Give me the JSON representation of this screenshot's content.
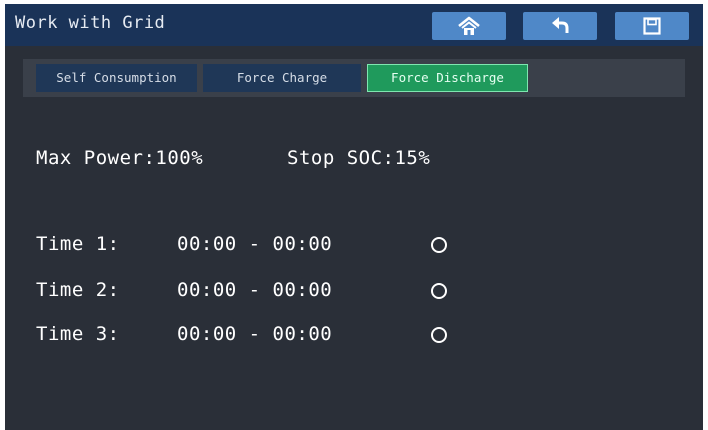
{
  "header": {
    "title": "Work with Grid",
    "buttons": [
      {
        "icon": "home-icon"
      },
      {
        "icon": "back-icon"
      },
      {
        "icon": "save-icon"
      }
    ]
  },
  "tabs": [
    {
      "label": "Self Consumption",
      "active": false
    },
    {
      "label": "Force Charge",
      "active": false
    },
    {
      "label": "Force Discharge",
      "active": true
    }
  ],
  "settings": {
    "max_power": "Max Power:100%",
    "stop_soc": "Stop SOC:15%"
  },
  "times": [
    {
      "label": "Time 1:",
      "range": "00:00 - 00:00",
      "selected": false
    },
    {
      "label": "Time 2:",
      "range": "00:00 - 00:00",
      "selected": false
    },
    {
      "label": "Time 3:",
      "range": "00:00 - 00:00",
      "selected": false
    }
  ],
  "colors": {
    "background": "#2a2f38",
    "header": "#1a3358",
    "header_button": "#4f88c8",
    "tab": "#1f3757",
    "tab_active": "#1f9a5c",
    "tab_active_border": "#7fe6b0",
    "text": "#ffffff"
  }
}
